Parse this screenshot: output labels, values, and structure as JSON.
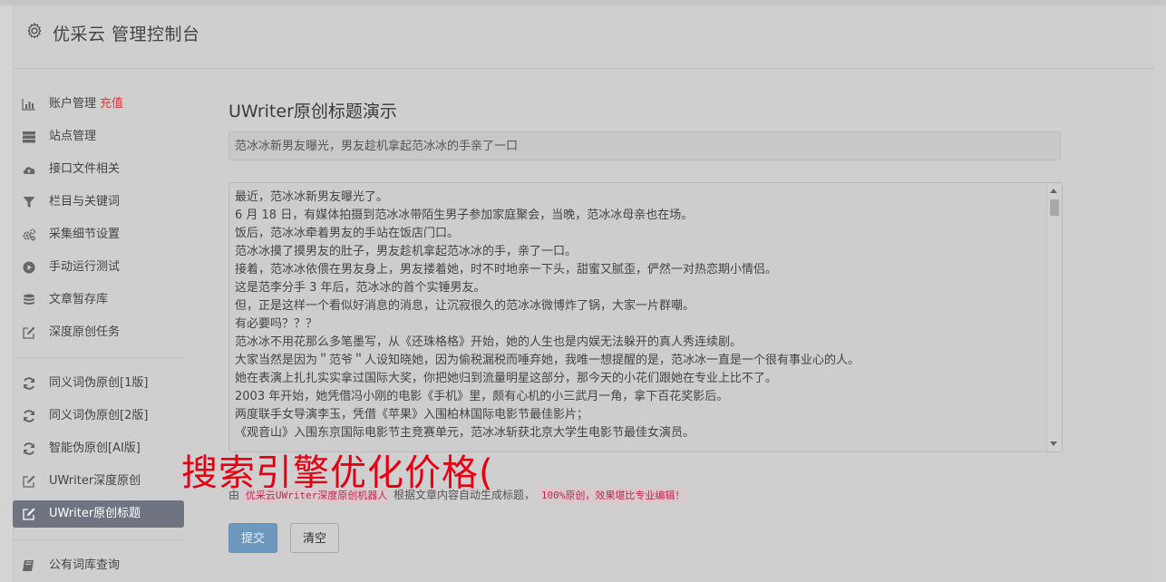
{
  "header": {
    "title": "优采云 管理控制台",
    "icon": "gear-icon"
  },
  "sidebar": {
    "items": [
      {
        "label": "账户管理",
        "badge": "充值",
        "icon": "bar-chart-icon"
      },
      {
        "label": "站点管理",
        "icon": "server-icon"
      },
      {
        "label": "接口文件相关",
        "icon": "cloud-upload-icon"
      },
      {
        "label": "栏目与关键词",
        "icon": "filter-icon"
      },
      {
        "label": "采集细节设置",
        "icon": "cogs-icon"
      },
      {
        "label": "手动运行测试",
        "icon": "play-circle-icon"
      },
      {
        "label": "文章暂存库",
        "icon": "database-icon"
      },
      {
        "label": "深度原创任务",
        "icon": "edit-icon"
      },
      {
        "label": "同义词伪原创[1版]",
        "icon": "refresh-icon"
      },
      {
        "label": "同义词伪原创[2版]",
        "icon": "refresh-icon"
      },
      {
        "label": "智能伪原创[AI版]",
        "icon": "refresh-icon"
      },
      {
        "label": "UWriter深度原创",
        "icon": "edit-icon"
      },
      {
        "label": "UWriter原创标题",
        "icon": "edit-icon",
        "active": true
      },
      {
        "label": "公有词库查询",
        "icon": "book-icon"
      }
    ]
  },
  "main": {
    "page_title": "UWriter原创标题演示",
    "title_value": "范冰冰新男友曝光，男友趁机拿起范冰冰的手亲了一口",
    "content_lines": [
      "最近，范冰冰新男友曝光了。",
      "6 月 18 日，有媒体拍摄到范冰冰带陌生男子参加家庭聚会，当晚，范冰冰母亲也在场。",
      "饭后，范冰冰牵着男友的手站在饭店门口。",
      "范冰冰摸了摸男友的肚子，男友趁机拿起范冰冰的手，亲了一口。",
      "接着，范冰冰依偎在男友身上，男友搂着她，时不时地亲一下头，甜蜜又腻歪，俨然一对热恋期小情侣。",
      "这是范李分手 3 年后，范冰冰的首个实锤男友。",
      "但，正是这样一个看似好消息的消息，让沉寂很久的范冰冰微博炸了锅，大家一片群嘲。",
      "有必要吗？？？",
      "范冰冰不用花那么多笔墨写，从《还珠格格》开始，她的人生也是内娱无法躲开的真人秀连续剧。",
      "大家当然是因为＂范爷＂人设知晓她，因为偷税漏税而唾弃她，我唯一想提醒的是，范冰冰一直是一个很有事业心的人。",
      "她在表演上扎扎实实拿过国际大奖，你把她归到流量明星这部分，那今天的小花们跟她在专业上比不了。",
      "2003 年开始，她凭借冯小刚的电影《手机》里，颇有心机的小三武月一角，拿下百花奖影后。",
      "两度联手女导演李玉，凭借《苹果》入围柏林国际电影节最佳影片；",
      "《观音山》入围东京国际电影节主竞赛单元，范冰冰斩获北京大学生电影节最佳女演员。"
    ],
    "overlay_text": "搜索引擎优化价格(",
    "note_prefix": "由",
    "note_code1": "优采云UWriter深度原创机器人",
    "note_middle": "根据文章内容自动生成标题，",
    "note_code2": "100%原创，效果堪比专业编辑！",
    "submit_label": "提交",
    "clear_label": "清空"
  },
  "colors": {
    "active_nav": "#6f7480",
    "badge": "#e43b3b",
    "submit": "#6c98be",
    "overlay": "#e60012",
    "code": "#c7254e"
  }
}
